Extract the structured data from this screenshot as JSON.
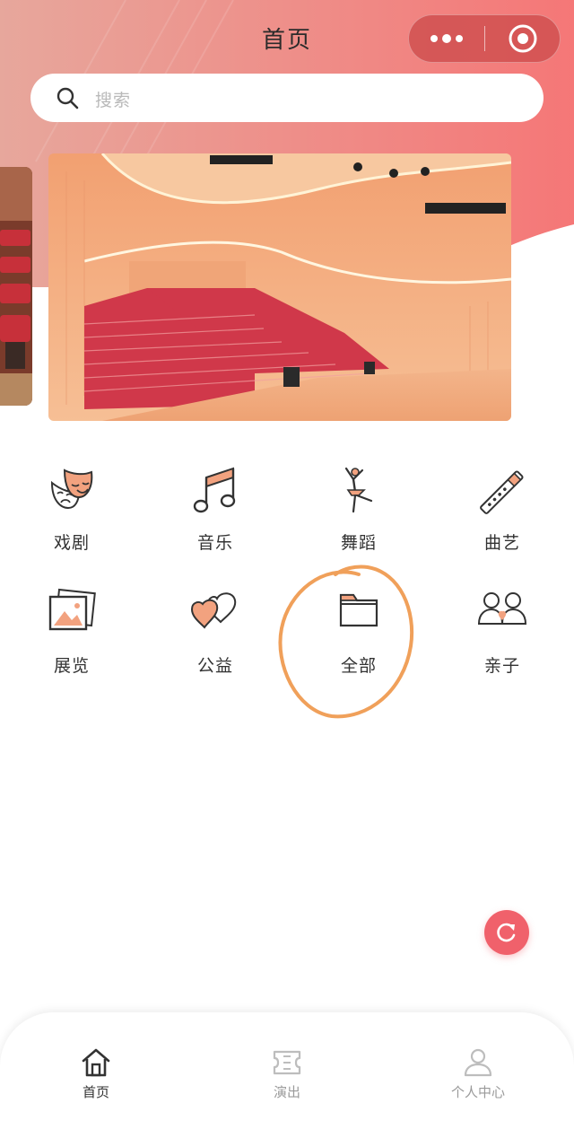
{
  "header": {
    "title": "首页",
    "menu_icon": "more-dots-icon",
    "close_icon": "target-circle-icon",
    "gradient_start": "#e9a39a",
    "gradient_end": "#f47b7b"
  },
  "search": {
    "placeholder": "搜索",
    "icon": "search-icon"
  },
  "banner": {
    "image": "concert-hall-photo",
    "prev_image": "concert-seats-photo"
  },
  "categories": [
    {
      "label": "戏剧",
      "icon": "theater-masks-icon"
    },
    {
      "label": "音乐",
      "icon": "music-note-icon"
    },
    {
      "label": "舞蹈",
      "icon": "dancer-icon"
    },
    {
      "label": "曲艺",
      "icon": "flute-icon"
    },
    {
      "label": "展览",
      "icon": "picture-frame-icon"
    },
    {
      "label": "公益",
      "icon": "hearts-icon"
    },
    {
      "label": "全部",
      "icon": "folder-icon"
    },
    {
      "label": "亲子",
      "icon": "family-icon"
    }
  ],
  "annotation": {
    "color": "#f0a05a",
    "shape": "hand-drawn circle"
  },
  "floating_button": {
    "icon": "refresh-icon",
    "color": "#f0616b"
  },
  "tabbar": {
    "items": [
      {
        "label": "首页",
        "icon": "home-icon",
        "active": true
      },
      {
        "label": "演出",
        "icon": "ticket-icon",
        "active": false
      },
      {
        "label": "个人中心",
        "icon": "person-icon",
        "active": false
      }
    ]
  }
}
